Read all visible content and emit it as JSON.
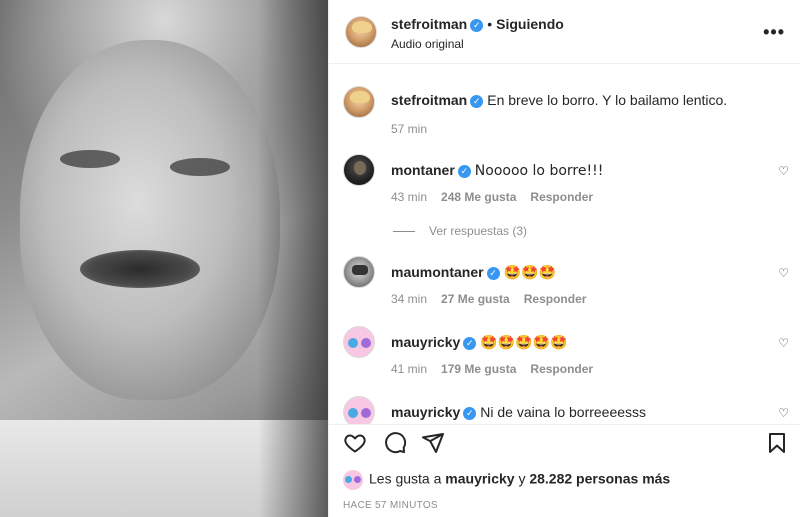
{
  "post": {
    "username": "stefroitman",
    "follow_dot": "•",
    "follow_label": "Siguiendo",
    "audio": "Audio original",
    "more": "•••"
  },
  "caption": {
    "username": "stefroitman",
    "text": "En breve lo borro. Y lo bailamo lentico.",
    "time": "57 min"
  },
  "comments": [
    {
      "username": "montaner",
      "text": "Nooooo lo borre!!!",
      "time": "43 min",
      "likes": "248 Me gusta",
      "reply": "Responder",
      "view_replies": "Ver respuestas (3)"
    },
    {
      "username": "maumontaner",
      "text": "🤩🤩🤩",
      "time": "34 min",
      "likes": "27 Me gusta",
      "reply": "Responder"
    },
    {
      "username": "mauyricky",
      "text": "🤩🤩🤩🤩🤩",
      "time": "41 min",
      "likes": "179 Me gusta",
      "reply": "Responder"
    },
    {
      "username": "mauyricky",
      "text": "Ni de vaina lo borreeeesss"
    }
  ],
  "likes_line": {
    "prefix": "Les gusta a",
    "user": "mauyricky",
    "middle": "y",
    "count": "28.282 personas más"
  },
  "timestamp": "HACE 57 MINUTOS",
  "colors": {
    "verified": "#3897f0",
    "meta": "#8e8e8e",
    "text": "#262626"
  }
}
